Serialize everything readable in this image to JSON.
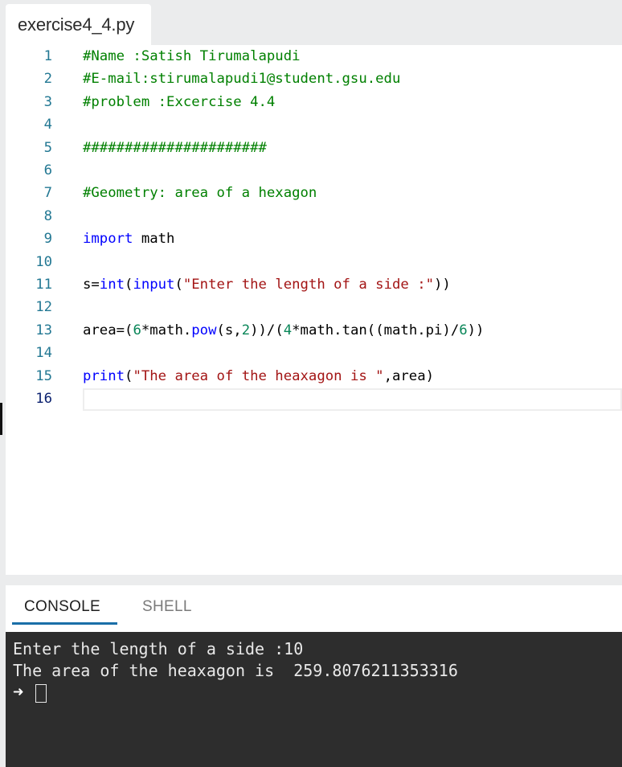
{
  "file_tab": {
    "name": "exercise4_4.py"
  },
  "editor": {
    "lines": [
      {
        "num": "1",
        "tokens": [
          {
            "t": "#Name :Satish Tirumalapudi",
            "c": "cm"
          }
        ]
      },
      {
        "num": "2",
        "tokens": [
          {
            "t": "#E-mail:stirumalapudi1@student.gsu.edu",
            "c": "cm"
          }
        ]
      },
      {
        "num": "3",
        "tokens": [
          {
            "t": "#problem :Excercise 4.4",
            "c": "cm"
          }
        ]
      },
      {
        "num": "4",
        "tokens": []
      },
      {
        "num": "5",
        "tokens": [
          {
            "t": "######################",
            "c": "cm"
          }
        ]
      },
      {
        "num": "6",
        "tokens": []
      },
      {
        "num": "7",
        "tokens": [
          {
            "t": "#Geometry: area of a hexagon",
            "c": "cm"
          }
        ]
      },
      {
        "num": "8",
        "tokens": []
      },
      {
        "num": "9",
        "tokens": [
          {
            "t": "import",
            "c": "kw"
          },
          {
            "t": " math",
            "c": ""
          }
        ]
      },
      {
        "num": "10",
        "tokens": []
      },
      {
        "num": "11",
        "tokens": [
          {
            "t": "s=",
            "c": ""
          },
          {
            "t": "int",
            "c": "kw"
          },
          {
            "t": "(",
            "c": ""
          },
          {
            "t": "input",
            "c": "kw"
          },
          {
            "t": "(",
            "c": ""
          },
          {
            "t": "\"Enter the length of a side :\"",
            "c": "str"
          },
          {
            "t": "))",
            "c": ""
          }
        ]
      },
      {
        "num": "12",
        "tokens": []
      },
      {
        "num": "13",
        "tokens": [
          {
            "t": "area=(",
            "c": ""
          },
          {
            "t": "6",
            "c": "num"
          },
          {
            "t": "*math.",
            "c": ""
          },
          {
            "t": "pow",
            "c": "kw"
          },
          {
            "t": "(s,",
            "c": ""
          },
          {
            "t": "2",
            "c": "num"
          },
          {
            "t": "))/(",
            "c": ""
          },
          {
            "t": "4",
            "c": "num"
          },
          {
            "t": "*math.tan((math.pi)/",
            "c": ""
          },
          {
            "t": "6",
            "c": "num"
          },
          {
            "t": "))",
            "c": ""
          }
        ]
      },
      {
        "num": "14",
        "tokens": []
      },
      {
        "num": "15",
        "tokens": [
          {
            "t": "print",
            "c": "kw"
          },
          {
            "t": "(",
            "c": ""
          },
          {
            "t": "\"The area of the heaxagon is \"",
            "c": "str"
          },
          {
            "t": ",area)",
            "c": ""
          }
        ]
      },
      {
        "num": "16",
        "tokens": []
      }
    ],
    "active_line": "16"
  },
  "console": {
    "tabs": [
      {
        "label": "CONSOLE"
      },
      {
        "label": "SHELL"
      }
    ],
    "active_tab": "CONSOLE",
    "output": [
      "Enter the length of a side :10",
      "The area of the heaxagon is  259.8076211353316"
    ],
    "prompt_symbol": "➜"
  }
}
